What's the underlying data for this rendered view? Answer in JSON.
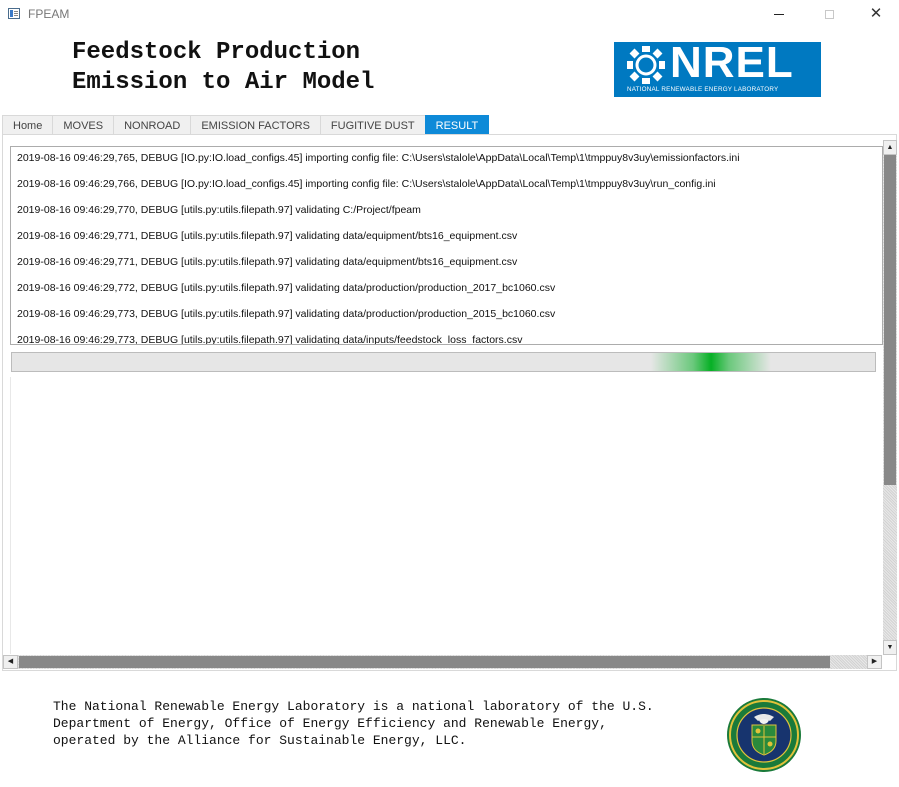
{
  "window": {
    "title": "FPEAM",
    "minimize_label": "",
    "maximize_label": "",
    "close_label": "✕"
  },
  "header": {
    "title_line1": "Feedstock Production",
    "title_line2": "Emission to Air Model",
    "logo_text": "NREL",
    "logo_subtext": "NATIONAL RENEWABLE ENERGY LABORATORY"
  },
  "tabs": [
    {
      "label": "Home",
      "active": false
    },
    {
      "label": "MOVES",
      "active": false
    },
    {
      "label": "NONROAD",
      "active": false
    },
    {
      "label": "EMISSION FACTORS",
      "active": false
    },
    {
      "label": "FUGITIVE DUST",
      "active": false
    },
    {
      "label": "RESULT",
      "active": true
    }
  ],
  "log": {
    "lines": [
      "2019-08-16 09:46:29,765, DEBUG    [IO.py:IO.load_configs.45] importing config file: C:\\Users\\stalole\\AppData\\Local\\Temp\\1\\tmppuy8v3uy\\emissionfactors.ini",
      "2019-08-16 09:46:29,766, DEBUG    [IO.py:IO.load_configs.45] importing config file: C:\\Users\\stalole\\AppData\\Local\\Temp\\1\\tmppuy8v3uy\\run_config.ini",
      "2019-08-16 09:46:29,770, DEBUG    [utils.py:utils.filepath.97] validating C:/Project/fpeam",
      "2019-08-16 09:46:29,771, DEBUG    [utils.py:utils.filepath.97] validating data/equipment/bts16_equipment.csv",
      "2019-08-16 09:46:29,771, DEBUG    [utils.py:utils.filepath.97] validating data/equipment/bts16_equipment.csv",
      "2019-08-16 09:46:29,772, DEBUG    [utils.py:utils.filepath.97] validating data/production/production_2017_bc1060.csv",
      "2019-08-16 09:46:29,773, DEBUG    [utils.py:utils.filepath.97] validating data/production/production_2015_bc1060.csv",
      "2019-08-16 09:46:29,773, DEBUG    [utils.py:utils.filepath.97] validating data/inputs/feedstock_loss_factors.csv"
    ]
  },
  "progress": {
    "indicator_position": 0.81
  },
  "scrollbars": {
    "up_arrow": "▲",
    "down_arrow": "▼",
    "left_arrow": "◀",
    "right_arrow": "▶"
  },
  "footer": {
    "text": "The National Renewable Energy Laboratory is a national laboratory of the U.S. Department of Energy, Office of Energy Efficiency and Renewable Energy, operated by the Alliance for Sustainable Energy, LLC."
  },
  "colors": {
    "accent": "#0e8ad8",
    "nrel_blue": "#0079c1",
    "progress_green": "#06b025"
  },
  "icons": {
    "app": "window-app-icon",
    "seal": "doe-seal-icon"
  }
}
